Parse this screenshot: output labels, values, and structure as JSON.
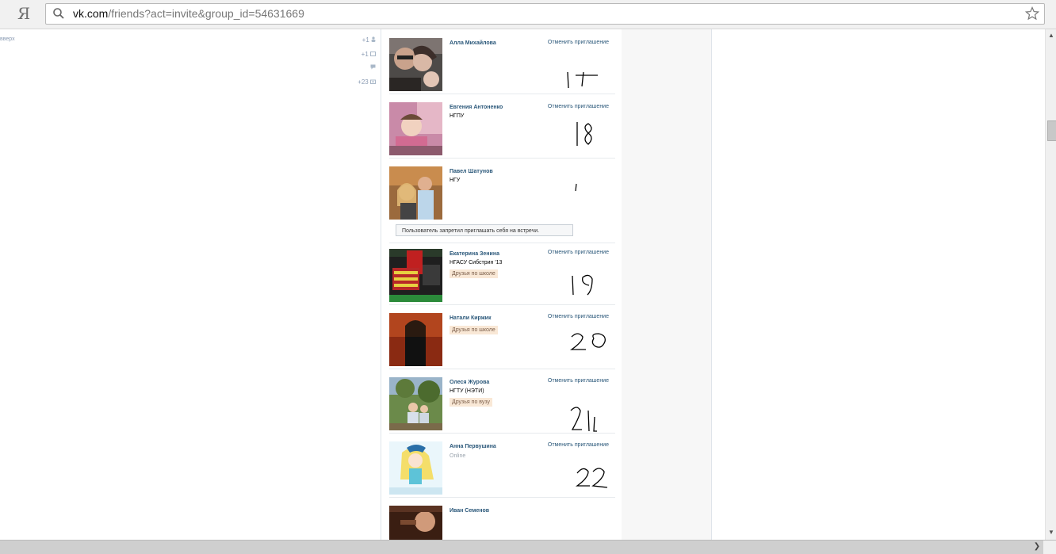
{
  "browser": {
    "logo": "Я",
    "url_host": "vk.com",
    "url_rest": "/friends?act=invite&group_id=54631669"
  },
  "left": {
    "up_link": "вверх",
    "counters": [
      "+1",
      "+1",
      "",
      "+23"
    ]
  },
  "list": {
    "cancel_label": "Отменить приглашение",
    "notice": "Пользователь запретил приглашать себя на встречи.",
    "rows": [
      {
        "name": "Алла Михайлова",
        "sub": "",
        "tag": "",
        "hand": "17"
      },
      {
        "name": "Евгения Антоненко",
        "sub": "НГПУ",
        "tag": "",
        "hand": "18"
      },
      {
        "name": "Павел Шатунов",
        "sub": "НГУ",
        "tag": "",
        "hand": "1"
      },
      {
        "name": "Екатерина Зенина",
        "sub": "НГАСУ Сибстрин '13",
        "tag": "Друзья по школе",
        "hand": "19"
      },
      {
        "name": "Натали Киржик",
        "sub": "",
        "tag": "Друзья по школе",
        "hand": "20"
      },
      {
        "name": "Олеся Журова",
        "sub": "НГТУ (НЭТИ)",
        "tag": "Друзья по вузу",
        "hand": "21"
      },
      {
        "name": "Анна Первушина",
        "sub": "Online",
        "tag": "",
        "hand": "22"
      },
      {
        "name": "Иван Семенов",
        "sub": "",
        "tag": "",
        "hand": ""
      }
    ]
  }
}
